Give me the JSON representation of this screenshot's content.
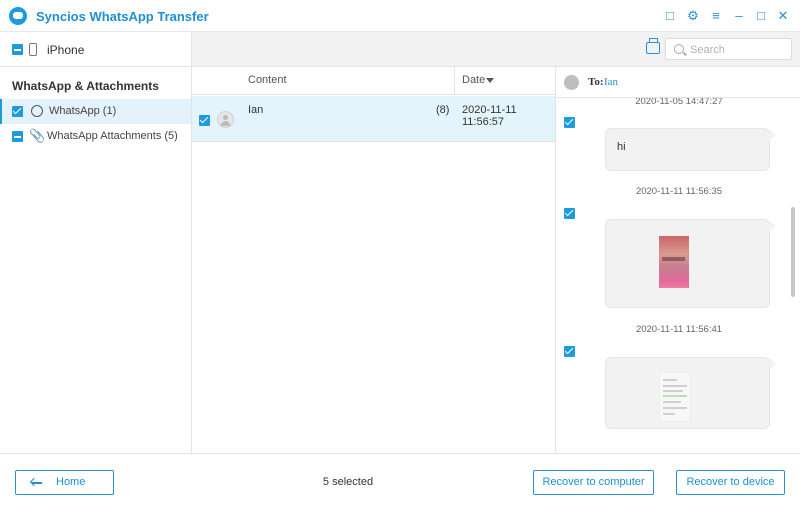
{
  "app": {
    "title": "Syncios WhatsApp Transfer",
    "accent_color": "#1e9bdc",
    "window_buttons": [
      "message-icon",
      "gear-icon",
      "menu-icon",
      "minimize-icon",
      "maximize-icon",
      "close-icon"
    ]
  },
  "device": {
    "name": "iPhone"
  },
  "sidebar": {
    "section_title": "WhatsApp & Attachments",
    "items": [
      {
        "label": "WhatsApp (1)",
        "icon": "whatsapp-icon",
        "active": true
      },
      {
        "label": "WhatsApp Attachments (5)",
        "icon": "paperclip-icon",
        "active": false
      }
    ]
  },
  "toolbar": {
    "search_placeholder": "Search",
    "search_value": ""
  },
  "list": {
    "columns": {
      "content": "Content",
      "date": "Date"
    },
    "rows": [
      {
        "name": "Ian",
        "count": "(8)",
        "date": "2020-11-11 11:56:57",
        "selected": true
      }
    ]
  },
  "conversation": {
    "to_label": "To:",
    "contact": "Ian",
    "messages": [
      {
        "time": "2020-11-05 14:47:27"
      },
      {
        "text": "hi",
        "time": "2020-11-11 11:56:35"
      },
      {
        "type": "photo",
        "time": "2020-11-11 11:56:41"
      },
      {
        "type": "screenshot"
      }
    ]
  },
  "footer": {
    "home_label": "Home",
    "selected_text": "5 selected",
    "recover_computer_label": "Recover to computer",
    "recover_device_label": "Recover to device"
  }
}
